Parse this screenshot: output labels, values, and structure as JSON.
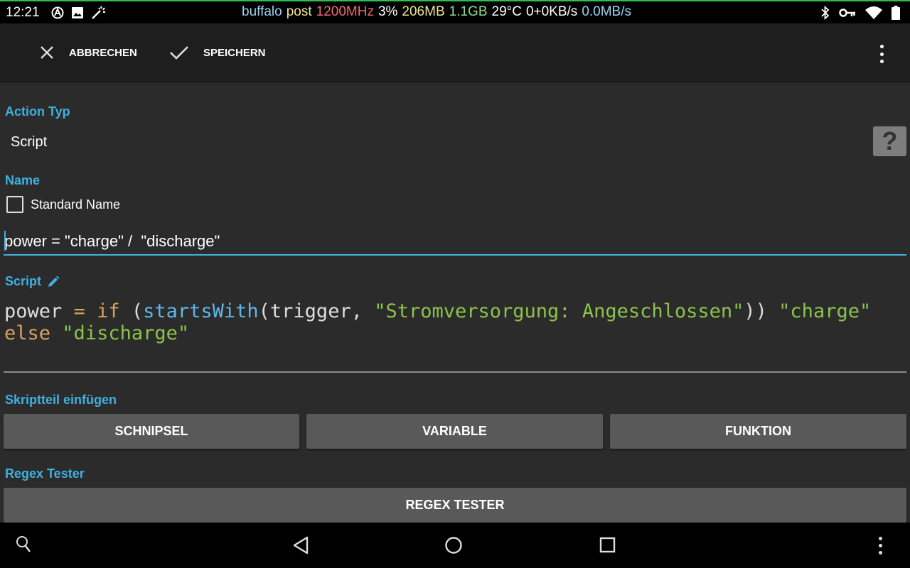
{
  "status_bar": {
    "time": "12:21",
    "left_icons": [
      "at-sign-icon",
      "image-icon",
      "magic-wand-icon"
    ],
    "stats": [
      {
        "text": "buffalo",
        "color": "#9ad3f5"
      },
      {
        "text": "post",
        "color": "#f0e68c"
      },
      {
        "text": "1200MHz",
        "color": "#f26b6b"
      },
      {
        "text": "3%",
        "color": "#ffffff"
      },
      {
        "text": "206MB",
        "color": "#f0e68c"
      },
      {
        "text": "1.1GB",
        "color": "#8fdc8f"
      },
      {
        "text": "29°C",
        "color": "#ffffff"
      },
      {
        "text": "0+0KB/s",
        "color": "#ffffff"
      },
      {
        "text": "0.0MB/s",
        "color": "#9ad3f5"
      }
    ],
    "right_icons": [
      "bluetooth-icon",
      "vpn-key-icon",
      "wifi-icon",
      "battery-icon"
    ]
  },
  "action_bar": {
    "cancel_label": "ABBRECHEN",
    "save_label": "SPEICHERN"
  },
  "action_type": {
    "label": "Action Typ",
    "value": "Script",
    "help_glyph": "?"
  },
  "name": {
    "label": "Name",
    "checkbox_label": "Standard Name",
    "checked": false,
    "value": "power = \"charge\" /  \"discharge\""
  },
  "script": {
    "label": "Script",
    "tokens": [
      {
        "t": "power ",
        "c": "plain"
      },
      {
        "t": "= ",
        "c": "kw"
      },
      {
        "t": "if",
        "c": "kw"
      },
      {
        "t": " (",
        "c": "plain"
      },
      {
        "t": "startsWith",
        "c": "fn"
      },
      {
        "t": "(trigger, ",
        "c": "plain"
      },
      {
        "t": "\"Stromversorgung: Angeschlossen\"",
        "c": "str"
      },
      {
        "t": ")) ",
        "c": "plain"
      },
      {
        "t": "\"charge\"",
        "c": "str"
      },
      {
        "t": "\n",
        "c": "br"
      },
      {
        "t": "else",
        "c": "kw"
      },
      {
        "t": " ",
        "c": "plain"
      },
      {
        "t": "\"discharge\"",
        "c": "str"
      }
    ]
  },
  "insert_section": {
    "label": "Skriptteil einfügen",
    "buttons": [
      "SCHNIPSEL",
      "VARIABLE",
      "FUNKTION"
    ]
  },
  "regex_section": {
    "label": "Regex Tester",
    "button": "REGEX TESTER"
  },
  "colors": {
    "accent": "#3fb1e0",
    "keyword": "#d9a15d",
    "function": "#5fb7e8",
    "string": "#8bc34a"
  }
}
